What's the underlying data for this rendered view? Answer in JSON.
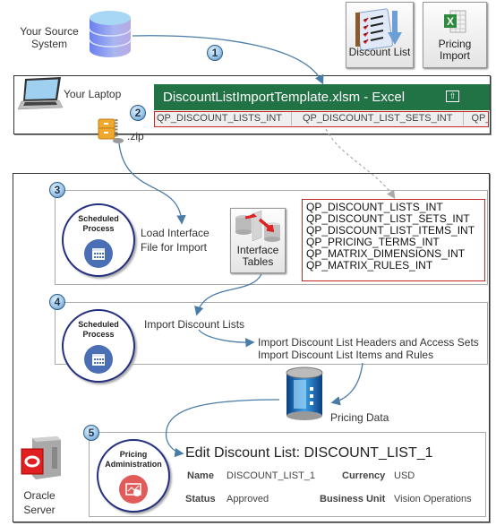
{
  "source_system": {
    "label_line1": "Your Source",
    "label_line2": "System",
    "icon": "database-icon"
  },
  "tiles": {
    "discount_list": {
      "label": "Discount List",
      "icon": "checklist-download-icon"
    },
    "pricing_import": {
      "label_line1": "Pricing",
      "label_line2": "Import",
      "icon": "excel-icon"
    }
  },
  "laptop": {
    "label": "Your Laptop",
    "icon": "laptop-icon",
    "zip_label": ".zip"
  },
  "excel": {
    "title": "DiscountListImportTemplate.xlsm - Excel",
    "restore_icon": "ribbon-display-icon",
    "sheet_tabs": [
      "QP_DISCOUNT_LISTS_INT",
      "QP_DISCOUNT_LIST_SETS_INT",
      "QP_"
    ]
  },
  "steps": [
    {
      "number": "1"
    },
    {
      "number": "2"
    },
    {
      "number": "3",
      "circle_title_1": "Scheduled",
      "circle_title_2": "Process",
      "action_line1": "Load Interface",
      "action_line2": "File for Import"
    },
    {
      "number": "4",
      "circle_title_1": "Scheduled",
      "circle_title_2": "Process",
      "action": "Import Discount Lists",
      "sub_action_1": "Import Discount List Headers and Access Sets",
      "sub_action_2": "Import Discount List Items and Rules"
    },
    {
      "number": "5",
      "circle_title_1": "Pricing",
      "circle_title_2": "Administration"
    }
  ],
  "interface_tables": {
    "label_line1": "Interface",
    "label_line2": "Tables",
    "tables": [
      "QP_DISCOUNT_LISTS_INT",
      "QP_DISCOUNT_LIST_SETS_INT",
      "QP_DISCOUNT_LIST_ITEMS_INT",
      "QP_PRICING_TERMS_INT",
      "QP_MATRIX_DIMENSIONS_INT",
      "QP_MATRIX_RULES_INT"
    ]
  },
  "pricing_data": {
    "label": "Pricing Data"
  },
  "oracle_server": {
    "label_line1": "Oracle",
    "label_line2": "Server"
  },
  "edit_discount": {
    "title": "Edit Discount List: DISCOUNT_LIST_1",
    "fields": [
      {
        "label": "Name",
        "value": "DISCOUNT_LIST_1"
      },
      {
        "label": "Currency",
        "value": "USD"
      },
      {
        "label": "Status",
        "value": "Approved"
      },
      {
        "label": "Business Unit",
        "value": "Vision Operations"
      }
    ]
  },
  "colors": {
    "excel_green": "#217346",
    "highlight_red": "#c62828",
    "circle_navy": "#24307f",
    "calendar_blue": "#4a6fb5",
    "pricing_red": "#e25b5b",
    "arrow_blue": "#4a7ca8"
  }
}
